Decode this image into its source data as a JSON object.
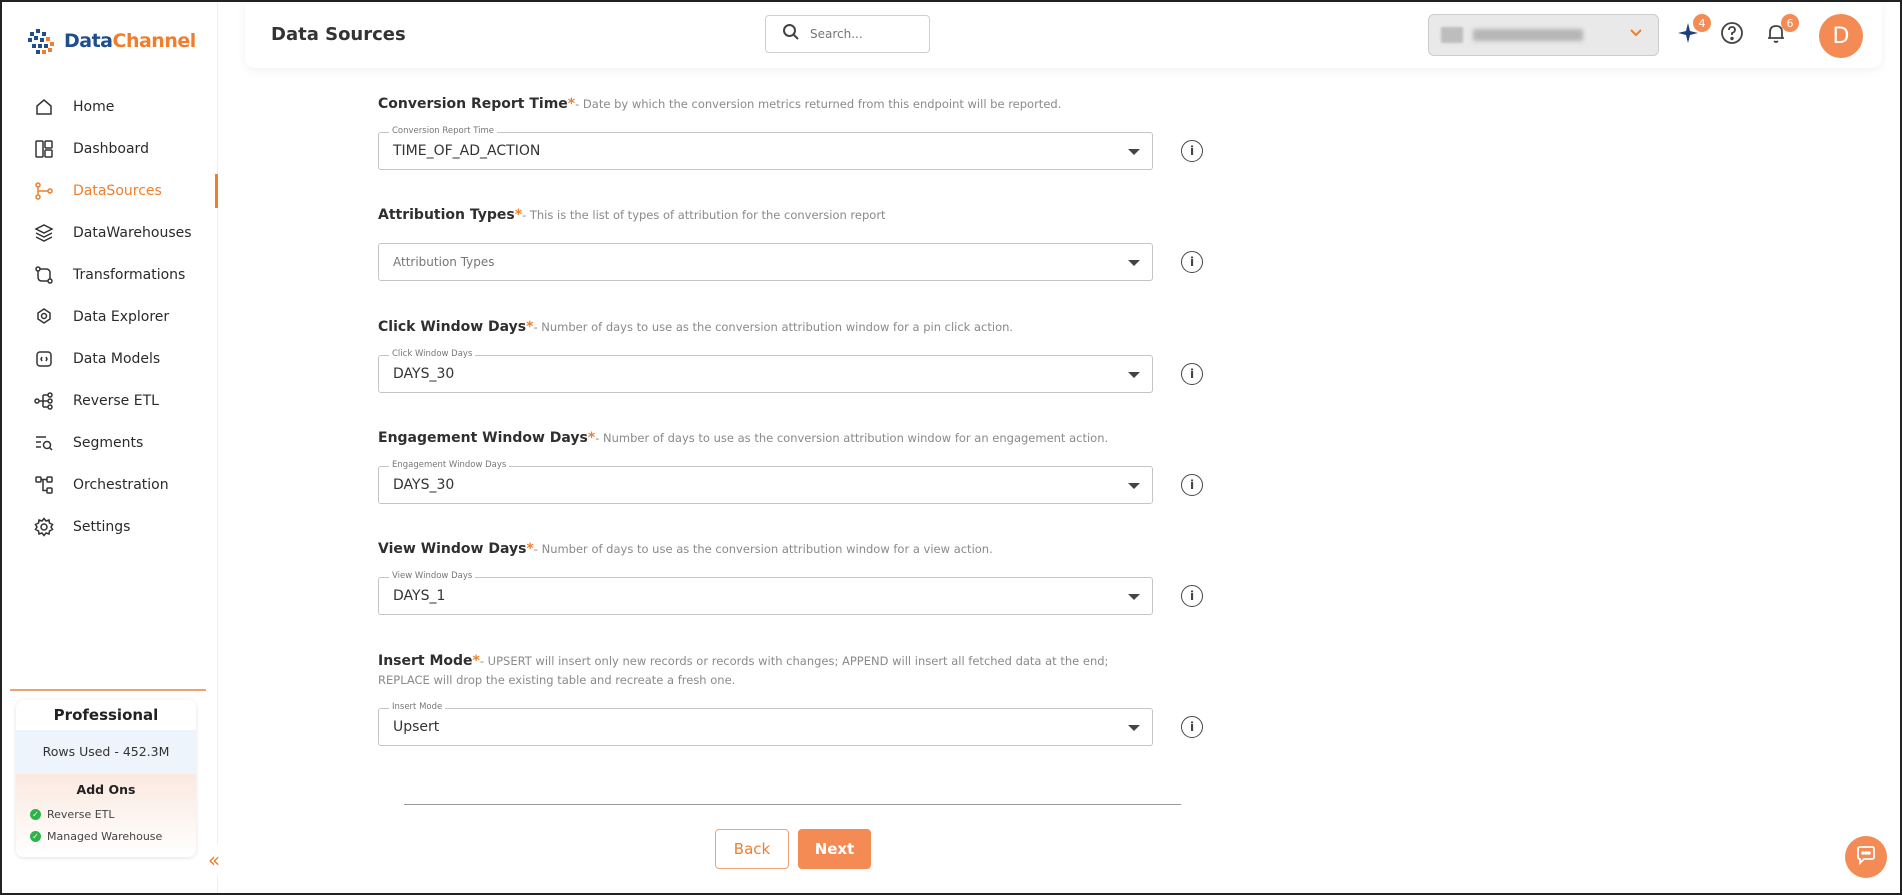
{
  "app": {
    "logo_part1": "Data",
    "logo_part2": "Channel"
  },
  "sidebar": {
    "items": [
      {
        "label": "Home",
        "icon": "home-icon"
      },
      {
        "label": "Dashboard",
        "icon": "dashboard-icon"
      },
      {
        "label": "DataSources",
        "icon": "datasources-icon",
        "active": true
      },
      {
        "label": "DataWarehouses",
        "icon": "layers-icon"
      },
      {
        "label": "Transformations",
        "icon": "transform-icon"
      },
      {
        "label": "Data Explorer",
        "icon": "explorer-icon"
      },
      {
        "label": "Data Models",
        "icon": "models-icon"
      },
      {
        "label": "Reverse ETL",
        "icon": "reverse-etl-icon"
      },
      {
        "label": "Segments",
        "icon": "segments-icon"
      },
      {
        "label": "Orchestration",
        "icon": "orchestration-icon"
      },
      {
        "label": "Settings",
        "icon": "settings-icon"
      }
    ],
    "plan": {
      "title": "Professional",
      "rows_used": "Rows Used - 452.3M",
      "addons_title": "Add Ons",
      "addons": [
        "Reverse ETL",
        "Managed Warehouse"
      ]
    }
  },
  "header": {
    "title": "Data Sources",
    "search_placeholder": "Search...",
    "sparkle_badge": "4",
    "notif_badge": "6",
    "avatar_initial": "D"
  },
  "form": {
    "fields": [
      {
        "label": "Conversion Report Time",
        "required": "*",
        "description": "- Date by which the conversion metrics returned from this endpoint will be reported.",
        "float_label": "Conversion Report Time",
        "value": "TIME_OF_AD_ACTION"
      },
      {
        "label": "Attribution Types",
        "required": "*",
        "description": "- This is the list of types of attribution for the conversion report",
        "placeholder": "Attribution Types"
      },
      {
        "label": "Click Window Days",
        "required": "*",
        "description": "- Number of days to use as the conversion attribution window for a pin click action.",
        "float_label": "Click Window Days",
        "value": "DAYS_30"
      },
      {
        "label": "Engagement Window Days",
        "required": "*",
        "description": "- Number of days to use as the conversion attribution window for an engagement action.",
        "float_label": "Engagement Window Days",
        "value": "DAYS_30"
      },
      {
        "label": "View Window Days",
        "required": "*",
        "description": "- Number of days to use as the conversion attribution window for a view action.",
        "float_label": "View Window Days",
        "value": "DAYS_1"
      },
      {
        "label": "Insert Mode",
        "required": "*",
        "description": "- UPSERT will insert only new records or records with changes; APPEND will insert all fetched data at the end;",
        "description2": "REPLACE will drop the existing table and recreate a fresh one.",
        "float_label": "Insert Mode",
        "value": "Upsert"
      }
    ],
    "back_label": "Back",
    "next_label": "Next"
  },
  "colors": {
    "accent": "#f07e2d",
    "accent_soft": "#f48b55"
  }
}
